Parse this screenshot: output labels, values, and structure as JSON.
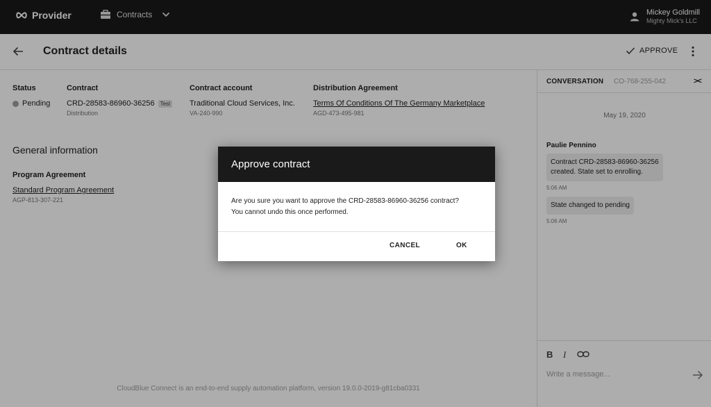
{
  "topbar": {
    "brand": "Provider",
    "module": "Contracts",
    "user_name": "Mickey Goldmill",
    "user_org": "Mighty Mick's LLC"
  },
  "page": {
    "title": "Contract details",
    "approve_label": "APPROVE"
  },
  "details": {
    "status_label": "Status",
    "status_value": "Pending",
    "contract_label": "Contract",
    "contract_id": "CRD-28583-86960-36256",
    "contract_tag": "Test",
    "contract_type": "Distribution",
    "account_label": "Contract account",
    "account_name": "Traditional Cloud Services, Inc.",
    "account_id": "VA-240-990",
    "distribution_label": "Distribution Agreement",
    "distribution_name": "Terms Of Conditions Of The Germany Marketplace",
    "distribution_id": "AGD-473-495-981"
  },
  "general": {
    "title": "General information",
    "program_label": "Program Agreement",
    "program_name": "Standard Program Agreement",
    "program_id": "AGP-813-307-221"
  },
  "footer": "CloudBlue Connect is an end-to-end supply automation platform, version 19.0.0-2019-g81cba0331",
  "conversation": {
    "title": "CONVERSATION",
    "id": "CO-768-255-042",
    "collapse": "><",
    "date": "May 19, 2020",
    "author": "Paulie Pennino",
    "messages": [
      {
        "text_line1": "Contract CRD-28583-86960-36256",
        "text_line2": "created. State set to enrolling.",
        "time": "5:06 AM"
      },
      {
        "text": "State changed to pending",
        "time": "5:06 AM"
      }
    ],
    "placeholder": "Write a message..."
  },
  "dialog": {
    "title": "Approve contract",
    "line1": "Are you sure you want to approve the CRD-28583-86960-36256 contract?",
    "line2": "You cannot undo this once performed.",
    "cancel": "CANCEL",
    "ok": "OK"
  },
  "colors": {
    "topbar": "#1a1a1a",
    "overlay": "rgba(0,0,0,0.32)"
  }
}
